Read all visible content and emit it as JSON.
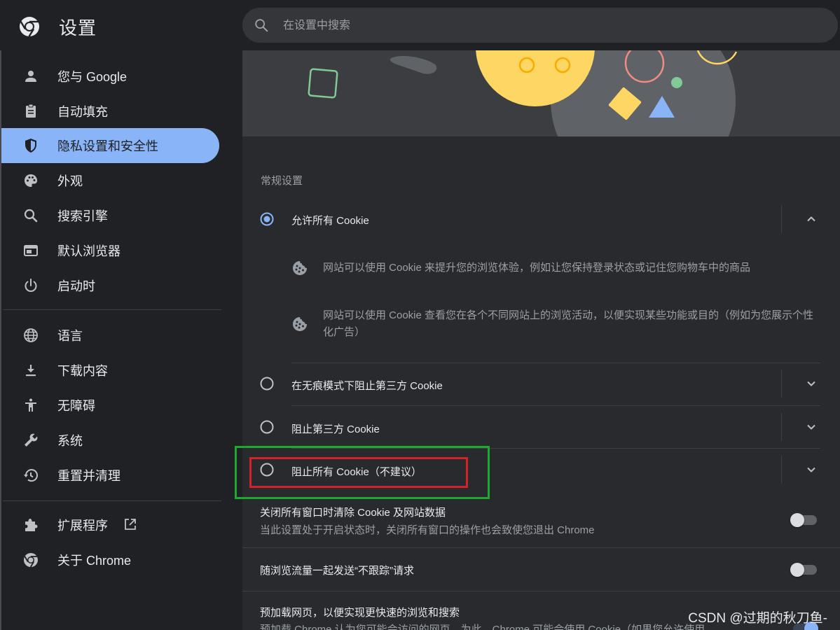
{
  "header": {
    "title": "设置",
    "search_placeholder": "在设置中搜索",
    "logo_icon": "chrome-logo-icon",
    "search_icon": "search-icon"
  },
  "sidebar": {
    "items": [
      {
        "label": "您与 Google",
        "icon": "person-icon"
      },
      {
        "label": "自动填充",
        "icon": "clipboard-icon"
      },
      {
        "label": "隐私设置和安全性",
        "icon": "shield-icon",
        "active": true
      },
      {
        "label": "外观",
        "icon": "palette-icon"
      },
      {
        "label": "搜索引擎",
        "icon": "search-icon"
      },
      {
        "label": "默认浏览器",
        "icon": "browser-icon"
      },
      {
        "label": "启动时",
        "icon": "power-icon"
      }
    ],
    "advanced": [
      {
        "label": "语言",
        "icon": "globe-icon"
      },
      {
        "label": "下载内容",
        "icon": "download-icon"
      },
      {
        "label": "无障碍",
        "icon": "accessibility-icon"
      },
      {
        "label": "系统",
        "icon": "wrench-icon"
      },
      {
        "label": "重置并清理",
        "icon": "history-icon"
      }
    ],
    "bottom": [
      {
        "label": "扩展程序",
        "icon": "puzzle-icon",
        "external_icon": "open-in-new-icon"
      },
      {
        "label": "关于 Chrome",
        "icon": "chrome-icon"
      }
    ],
    "active_color": "#8ab4f8"
  },
  "main": {
    "section_label": "常规设置",
    "options": [
      {
        "label": "允许所有 Cookie",
        "selected": true,
        "expanded": true
      },
      {
        "label": "在无痕模式下阻止第三方 Cookie",
        "selected": false
      },
      {
        "label": "阻止第三方 Cookie",
        "selected": false
      },
      {
        "label": "阻止所有 Cookie（不建议）",
        "selected": false
      }
    ],
    "expanded_details": [
      "网站可以使用 Cookie 来提升您的浏览体验，例如让您保持登录状态或记住您购物车中的商品",
      "网站可以使用 Cookie 查看您在各个不同网站上的浏览活动，以便实现某些功能或目的（例如为您展示个性化广告）"
    ],
    "toggles": [
      {
        "title": "关闭所有窗口时清除 Cookie 及网站数据",
        "subtitle": "当此设置处于开启状态时，关闭所有窗口的操作也会致使您退出 Chrome",
        "on": false
      },
      {
        "title": "随浏览流量一起发送“不跟踪”请求",
        "subtitle": "",
        "on": false
      },
      {
        "title": "预加载网页，以便实现更快速的浏览和搜索",
        "subtitle": "预加载 Chrome 认为您可能会访问的网页。为此，Chrome 可能会使用 Cookie（如果您允许使用",
        "on": true
      }
    ]
  },
  "annotations": {
    "green_box_color": "#1fa830",
    "red_box_color": "#d2232a"
  },
  "watermark": "CSDN @过期的秋刀鱼-"
}
